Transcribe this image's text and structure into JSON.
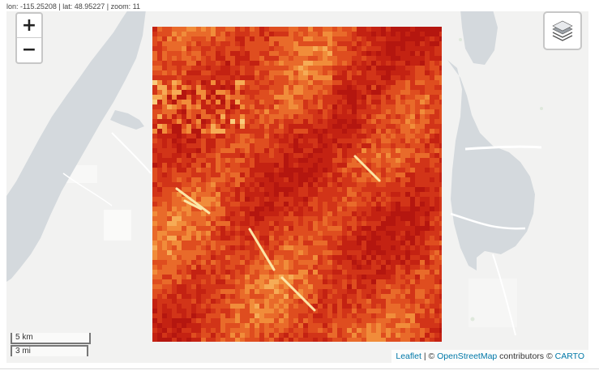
{
  "status_bar": {
    "coordinates": "lon: -115.25208 | lat: 48.95227 | zoom: 11"
  },
  "map": {
    "zoom_control": {
      "zoom_in_label": "+",
      "zoom_out_label": "−"
    },
    "layers_control": {
      "icon": "layers-icon"
    },
    "scale": {
      "metric_label": "5 km",
      "imperial_label": "3 mi"
    },
    "attribution": {
      "leaflet_link": "Leaflet",
      "separator": " | © ",
      "osm_link": "OpenStreetMap",
      "contributors_text": " contributors © ",
      "carto_link": "CARTO"
    },
    "raster_palette": [
      "#b5160f",
      "#c42212",
      "#d23418",
      "#df4d1f",
      "#e96a2a",
      "#f18c3a",
      "#f6ab55",
      "#f9cd7d",
      "#fbe6a6"
    ],
    "basemap_colors": {
      "land": "#f2f2f1",
      "water": "#d4d9dd",
      "roads": "#ffffff"
    }
  }
}
